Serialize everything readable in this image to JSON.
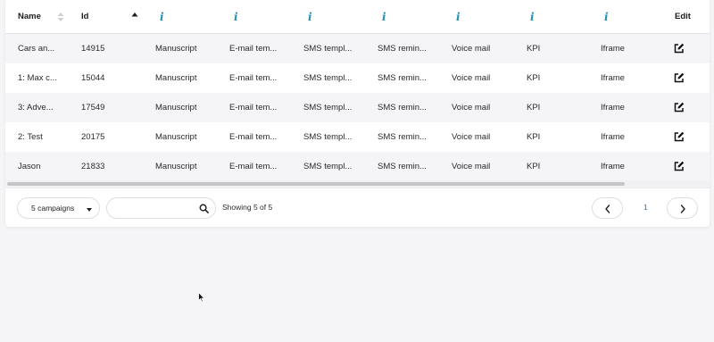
{
  "columns": {
    "name": "Name",
    "id": "Id",
    "info_icon": "info-icon",
    "edit": "Edit"
  },
  "rows": [
    {
      "name": "Cars an...",
      "id": "14915",
      "manuscript": "Manuscript",
      "email": "E-mail tem...",
      "sms": "SMS templ...",
      "reminder": "SMS remin...",
      "voice": "Voice mail",
      "kpi": "KPI",
      "iframe": "Iframe"
    },
    {
      "name": "1: Max c...",
      "id": "15044",
      "manuscript": "Manuscript",
      "email": "E-mail tem...",
      "sms": "SMS templ...",
      "reminder": "SMS remin...",
      "voice": "Voice mail",
      "kpi": "KPI",
      "iframe": "Iframe"
    },
    {
      "name": "3: Adve...",
      "id": "17549",
      "manuscript": "Manuscript",
      "email": "E-mail tem...",
      "sms": "SMS templ...",
      "reminder": "SMS remin...",
      "voice": "Voice mail",
      "kpi": "KPI",
      "iframe": "Iframe"
    },
    {
      "name": "2: Test",
      "id": "20175",
      "manuscript": "Manuscript",
      "email": "E-mail tem...",
      "sms": "SMS templ...",
      "reminder": "SMS remin...",
      "voice": "Voice mail",
      "kpi": "KPI",
      "iframe": "Iframe"
    },
    {
      "name": "Jason",
      "id": "21833",
      "manuscript": "Manuscript",
      "email": "E-mail tem...",
      "sms": "SMS templ...",
      "reminder": "SMS remin...",
      "voice": "Voice mail",
      "kpi": "KPI",
      "iframe": "Iframe"
    }
  ],
  "footer": {
    "campaign_select": "5 campaigns",
    "search_value": "",
    "showing": "Showing 5 of 5",
    "current_page": "1"
  },
  "colors": {
    "accent": "#1f8fb4",
    "row_alt": "#f5f4f7",
    "page_link": "#1f6fb4"
  }
}
